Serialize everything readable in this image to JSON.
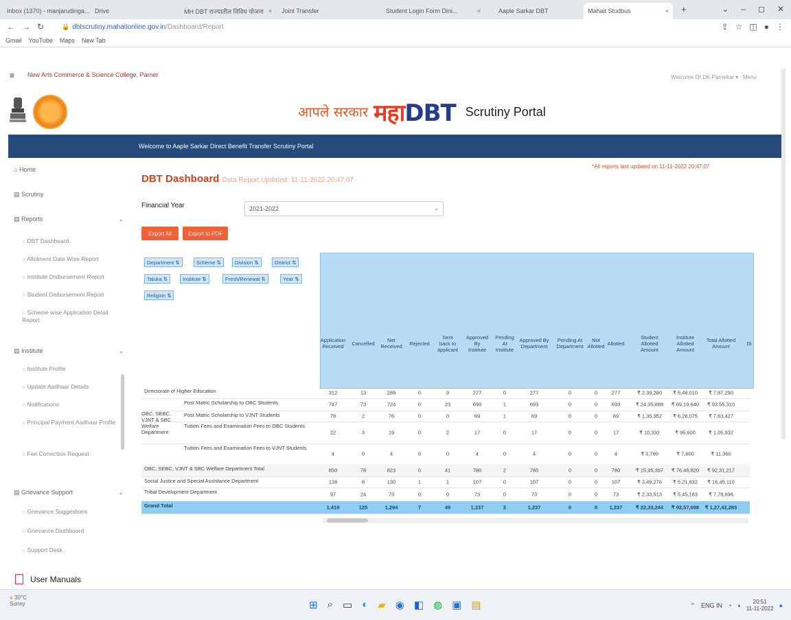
{
  "browser": {
    "tabs": [
      "Inbox (1370) - manjarudinga...",
      "Drive",
      "MH DBT राज्यातील विविध योजना",
      "Joint Transfer",
      "Student Login Form Dini...",
      "Aaple Sarkar DBT",
      "Mahait Studbus"
    ],
    "url_host": "dbtscrutiny.mahaitonline.gov.in",
    "url_path": "/Dashboard/Report",
    "bookmarks": [
      "Gmail",
      "YouTube",
      "Maps",
      "New Tab"
    ]
  },
  "site": {
    "college": "New Arts Commerce & Science College, Parner",
    "welcome": "Welcome Dr DK Parnekar ▾",
    "menu_label": "Menu",
    "logo_hindi": "आपले सरकार",
    "logo_maha": "महा",
    "logo_dbt": "DBT",
    "logo_portal": "Scrutiny Portal",
    "banner": "Welcome to Aaple Sarkar Direct Benefit Transfer Scrutiny Portal"
  },
  "sidebar": {
    "items": [
      "Home",
      "Scrutiny",
      "Reports",
      "DBT Dashboard",
      "Allotment Date Wise Report",
      "Institute Disbursement Report",
      "Student Disbursement Report",
      "Scheme wise Application Detail Report",
      "Institute",
      "Institute Profile",
      "Update Aadhaar Details",
      "Notifications",
      "Principal Payment Aadhaar Profile",
      "Fee Correction Request",
      "Grievance Support",
      "Grievance Suggestions",
      "Grievance Dashboard",
      "Support Desk"
    ],
    "user_manuals": "User Manuals"
  },
  "dashboard": {
    "title": "DBT Dashboard",
    "updated": "Data Report Updated: 11-11-2022 20:47:07",
    "note": "*All reports last updated on 11-11-2022 20:47:07",
    "fy_label": "Financial Year",
    "fy_value": "2021-2022",
    "export_all": "Export All",
    "export_pdf": "Export to PDF",
    "filters": [
      "Department",
      "Scheme",
      "Division",
      "District",
      "Taluka",
      "Institute",
      "Fresh/Renewal",
      "Year",
      "Religion"
    ],
    "columns": [
      "Application Received",
      "Cancelled",
      "Net Received",
      "Rejected",
      "Sent back to applicant",
      "Approved By Institute",
      "Pending At Institute",
      "Approved By Department",
      "Pending At Department",
      "Not Allotted",
      "Allotted",
      "Student Allotted Amount",
      "Institute Allotted Amount",
      "Total Allotted Amount",
      "Di"
    ],
    "group_label": "OBC, SEBC, VJNT & SBC Welfare Department",
    "rows": [
      {
        "label": "Directorate of Higher Education",
        "vals": [
          "312",
          "13",
          "289",
          "0",
          "9",
          "277",
          "0",
          "277",
          "0",
          "0",
          "277",
          "₹ 2,39,280",
          "₹ 5,48,010",
          "₹ 7,87,290"
        ]
      },
      {
        "label": "Post Matric Scholarship to OBC Students",
        "vals": [
          "747",
          "73",
          "724",
          "0",
          "23",
          "690",
          "1",
          "693",
          "0",
          "0",
          "693",
          "₹ 24,35,888",
          "₹ 69,19,640",
          "₹ 93,55,310"
        ]
      },
      {
        "label": "Post Matric Scholarship to VJNT Students",
        "vals": [
          "78",
          "2",
          "76",
          "0",
          "0",
          "69",
          "1",
          "69",
          "0",
          "0",
          "69",
          "₹ 1,35,352",
          "₹ 6,28,075",
          "₹ 7,63,427"
        ]
      },
      {
        "label": "Tuition Fees and Examination Fees to OBC Students",
        "vals": [
          "22",
          "3",
          "19",
          "0",
          "2",
          "17",
          "0",
          "17",
          "0",
          "0",
          "17",
          "₹ 10,332",
          "₹ 95,600",
          "₹ 1,05,932"
        ]
      },
      {
        "label": "Tuition Fees and Examination Fees to VJNT Students",
        "vals": [
          "4",
          "0",
          "4",
          "0",
          "0",
          "4",
          "0",
          "4",
          "0",
          "0",
          "4",
          "₹ 3,760",
          "₹ 7,600",
          "₹ 11,360"
        ]
      },
      {
        "label": "OBC, SEBC, VJNT & SBC Welfare Department Total",
        "vals": [
          "850",
          "78",
          "823",
          "0",
          "41",
          "780",
          "2",
          "780",
          "0",
          "0",
          "780",
          "₹ 15,95,397",
          "₹ 76,46,820",
          "₹ 92,31,217"
        ]
      },
      {
        "label": "Social Justice and Special Assistance Department",
        "vals": [
          "138",
          "8",
          "130",
          "1",
          "1",
          "107",
          "0",
          "107",
          "0",
          "0",
          "107",
          "₹ 3,49,276",
          "₹ 5,21,832",
          "₹ 16,45,110"
        ]
      },
      {
        "label": "Tribal Development Department",
        "vals": [
          "97",
          "24",
          "73",
          "0",
          "0",
          "73",
          "0",
          "73",
          "0",
          "0",
          "73",
          "₹ 2,33,513",
          "₹ 5,45,183",
          "₹ 7,78,696"
        ]
      },
      {
        "label": "Grand Total",
        "vals": [
          "1,419",
          "125",
          "1,294",
          "7",
          "49",
          "1,237",
          "2",
          "1,237",
          "0",
          "0",
          "1,237",
          "₹ 22,33,244",
          "₹ 92,57,098",
          "₹ 1,27,42,283"
        ]
      }
    ]
  },
  "taskbar": {
    "weather_temp": "30°C",
    "weather_desc": "Sunny",
    "lang": "ENG IN",
    "time": "20:51",
    "date": "11-11-2022"
  }
}
